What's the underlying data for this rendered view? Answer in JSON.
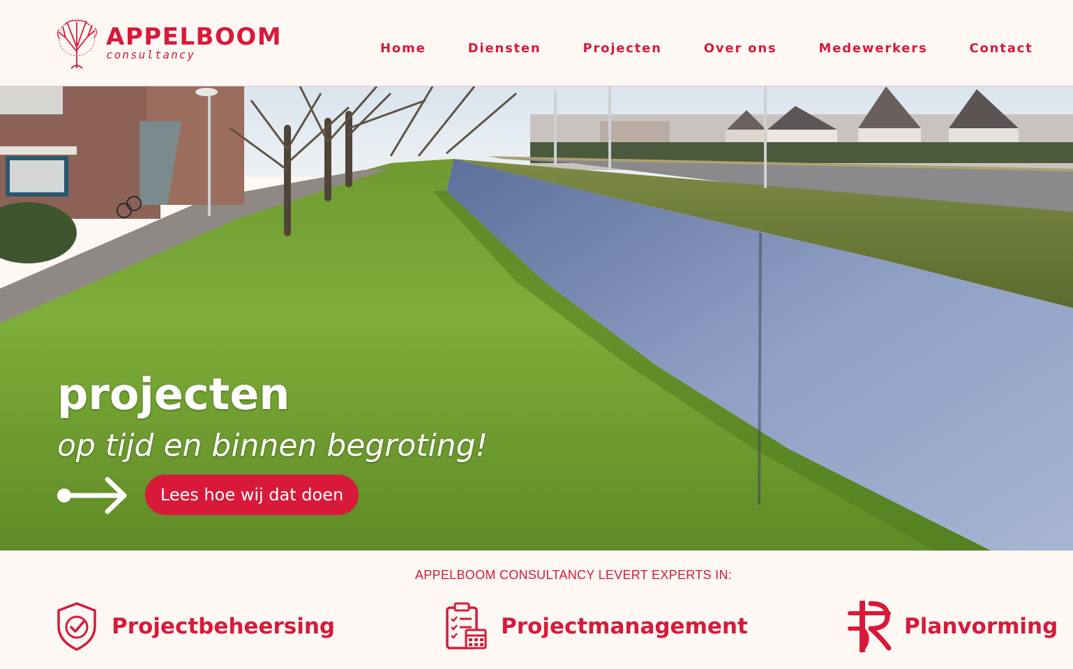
{
  "brand": {
    "name": "APPELBOOM",
    "tagline": "consultancy",
    "color": "#d8193a",
    "background": "#fdf8f3"
  },
  "nav": {
    "items": [
      {
        "label": "Home"
      },
      {
        "label": "Diensten"
      },
      {
        "label": "Projecten"
      },
      {
        "label": "Over ons"
      },
      {
        "label": "Medewerkers"
      },
      {
        "label": "Contact"
      }
    ]
  },
  "hero": {
    "title": "projecten",
    "subtitle": "op tijd en binnen begroting!",
    "cta_label": "Lees hoe wij dat doen",
    "arrow_icon": "right-arrow-icon",
    "image": "photo of a canal beside a grass strip with trees and houses"
  },
  "experts": {
    "heading": "APPELBOOM CONSULTANCY LEVERT EXPERTS IN:",
    "items": [
      {
        "label": "Projectbeheersing",
        "icon": "shield-check-icon"
      },
      {
        "label": "Projectmanagement",
        "icon": "clipboard-calendar-icon"
      },
      {
        "label": "Planvorming",
        "icon": "road-plan-icon"
      }
    ]
  }
}
